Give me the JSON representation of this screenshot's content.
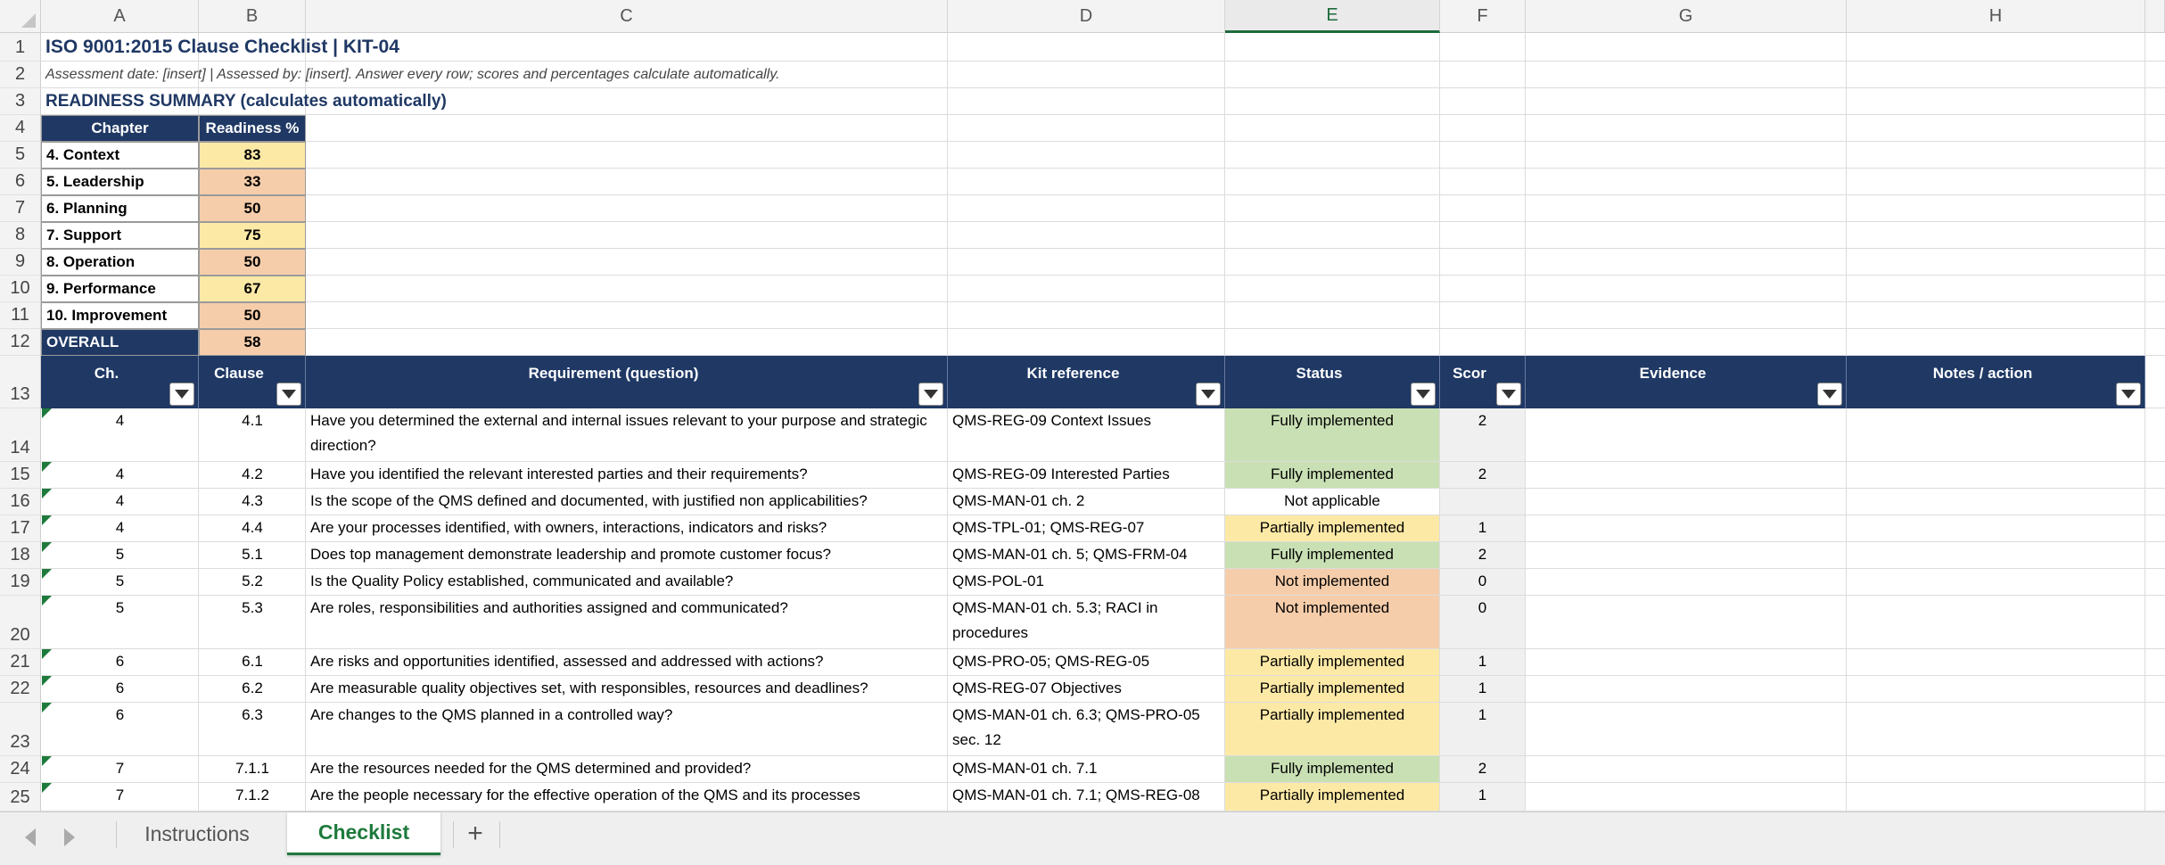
{
  "columns": [
    "A",
    "B",
    "C",
    "D",
    "E",
    "F",
    "G",
    "H"
  ],
  "selected_column": "E",
  "row_numbers": [
    "1",
    "2",
    "3",
    "4",
    "5",
    "6",
    "7",
    "8",
    "9",
    "10",
    "11",
    "12",
    "13",
    "14",
    "15",
    "16",
    "17",
    "18",
    "19",
    "20",
    "21",
    "22",
    "23",
    "24",
    "25"
  ],
  "title": "ISO 9001:2015 Clause Checklist | KIT-04",
  "subtitle": "Assessment date: [insert] | Assessed by: [insert]. Answer every row; scores and percentages calculate automatically.",
  "summary": {
    "heading": "READINESS SUMMARY (calculates automatically)",
    "col_chapter": "Chapter",
    "col_readiness": "Readiness %",
    "rows": [
      {
        "chapter": "4. Context",
        "pct": "83"
      },
      {
        "chapter": "5. Leadership",
        "pct": "33"
      },
      {
        "chapter": "6. Planning",
        "pct": "50"
      },
      {
        "chapter": "7. Support",
        "pct": "75"
      },
      {
        "chapter": "8. Operation",
        "pct": "50"
      },
      {
        "chapter": "9. Performance",
        "pct": "67"
      },
      {
        "chapter": "10. Improvement",
        "pct": "50"
      }
    ],
    "overall_label": "OVERALL",
    "overall_pct": "58"
  },
  "table_headers": [
    "Ch.",
    "Clause",
    "Requirement (question)",
    "Kit reference",
    "Status",
    "Scor",
    "Evidence",
    "Notes / action"
  ],
  "rows": [
    {
      "ch": "4",
      "clause": "4.1",
      "req": "Have you determined the external and internal issues relevant to your purpose and strategic direction?",
      "ref": "QMS-REG-09 Context Issues",
      "status": "Fully implemented",
      "score": "2"
    },
    {
      "ch": "4",
      "clause": "4.2",
      "req": "Have you identified the relevant interested parties and their requirements?",
      "ref": "QMS-REG-09 Interested Parties",
      "status": "Fully implemented",
      "score": "2"
    },
    {
      "ch": "4",
      "clause": "4.3",
      "req": "Is the scope of the QMS defined and documented, with justified non applicabilities?",
      "ref": "QMS-MAN-01 ch. 2",
      "status": "Not applicable",
      "score": ""
    },
    {
      "ch": "4",
      "clause": "4.4",
      "req": "Are your processes identified, with owners, interactions, indicators and risks?",
      "ref": "QMS-TPL-01; QMS-REG-07",
      "status": "Partially implemented",
      "score": "1"
    },
    {
      "ch": "5",
      "clause": "5.1",
      "req": "Does top management demonstrate leadership and promote customer focus?",
      "ref": "QMS-MAN-01 ch. 5; QMS-FRM-04",
      "status": "Fully implemented",
      "score": "2"
    },
    {
      "ch": "5",
      "clause": "5.2",
      "req": "Is the Quality Policy established, communicated and available?",
      "ref": "QMS-POL-01",
      "status": "Not implemented",
      "score": "0"
    },
    {
      "ch": "5",
      "clause": "5.3",
      "req": "Are roles, responsibilities and authorities assigned and communicated?",
      "ref": "QMS-MAN-01 ch. 5.3; RACI in procedures",
      "status": "Not implemented",
      "score": "0"
    },
    {
      "ch": "6",
      "clause": "6.1",
      "req": "Are risks and opportunities identified, assessed and addressed with actions?",
      "ref": "QMS-PRO-05; QMS-REG-05",
      "status": "Partially implemented",
      "score": "1"
    },
    {
      "ch": "6",
      "clause": "6.2",
      "req": "Are measurable quality objectives set, with responsibles, resources and deadlines?",
      "ref": "QMS-REG-07 Objectives",
      "status": "Partially implemented",
      "score": "1"
    },
    {
      "ch": "6",
      "clause": "6.3",
      "req": "Are changes to the QMS planned in a controlled way?",
      "ref": "QMS-MAN-01 ch. 6.3; QMS-PRO-05 sec. 12",
      "status": "Partially implemented",
      "score": "1"
    },
    {
      "ch": "7",
      "clause": "7.1.1",
      "req": "Are the resources needed for the QMS determined and provided?",
      "ref": "QMS-MAN-01 ch. 7.1",
      "status": "Fully implemented",
      "score": "2"
    },
    {
      "ch": "7",
      "clause": "7.1.2",
      "req": "Are the people necessary for the effective operation of the QMS and its processes",
      "ref": "QMS-MAN-01 ch. 7.1; QMS-REG-08",
      "status": "Partially implemented",
      "score": "1"
    }
  ],
  "tabs": [
    "Instructions",
    "Checklist"
  ],
  "active_tab": "Checklist",
  "add_tab_label": "+",
  "colors": {
    "navy": "#1f3864",
    "green": "#c9e0b4",
    "yellow": "#fde9a6",
    "orange": "#f6cdaa",
    "accent": "#1e7a3c"
  }
}
